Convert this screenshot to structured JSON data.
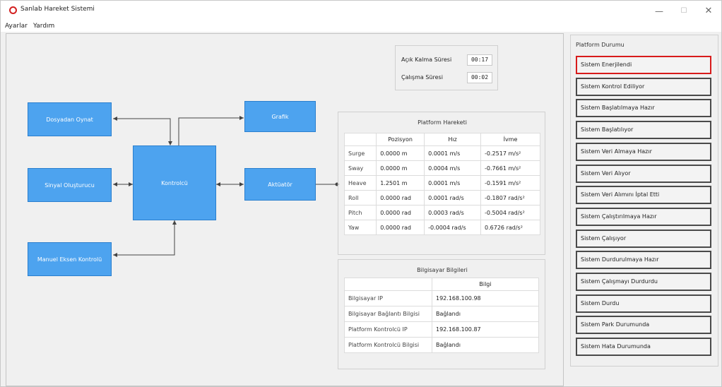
{
  "window": {
    "title": "Sanlab Hareket Sistemi",
    "minimize": "—",
    "maximize": "☐",
    "close": "✕"
  },
  "menu": {
    "items": [
      "Ayarlar",
      "Yardım"
    ]
  },
  "blocks": {
    "file_play": "Dosyadan Oynat",
    "signal_gen": "Sinyal Oluşturucu",
    "manual_axis": "Manuel Eksen Kontrolü",
    "controller": "Kontrolcü",
    "graph": "Grafik",
    "actuator": "Aktüatör"
  },
  "times": {
    "uptime_label": "Açık Kalma Süresi",
    "uptime_value": "00:17",
    "runtime_label": "Çalışma Süresi",
    "runtime_value": "00:02"
  },
  "motion": {
    "title": "Platform Hareketi",
    "headers": [
      "Pozisyon",
      "Hız",
      "İvme"
    ],
    "rows": [
      {
        "name": "Surge",
        "pos": "0.0000 m",
        "vel": "0.0001 m/s",
        "acc": "-0.2517 m/s²"
      },
      {
        "name": "Sway",
        "pos": "0.0000 m",
        "vel": "0.0004 m/s",
        "acc": "-0.7661 m/s²"
      },
      {
        "name": "Heave",
        "pos": "1.2501 m",
        "vel": "0.0001 m/s",
        "acc": "-0.1591 m/s²"
      },
      {
        "name": "Roll",
        "pos": "0.0000 rad",
        "vel": "0.0001 rad/s",
        "acc": "-0.1807 rad/s²"
      },
      {
        "name": "Pitch",
        "pos": "0.0000 rad",
        "vel": "0.0003 rad/s",
        "acc": "-0.5004 rad/s²"
      },
      {
        "name": "Yaw",
        "pos": "0.0000 rad",
        "vel": "-0.0004 rad/s",
        "acc": "0.6726 rad/s²"
      }
    ]
  },
  "computer": {
    "title": "Bilgisayar Bilgileri",
    "header": "Bilgi",
    "rows": [
      {
        "label": "Bilgisayar IP",
        "value": "192.168.100.98"
      },
      {
        "label": "Bilgisayar Bağlantı Bilgisi",
        "value": "Bağlandı"
      },
      {
        "label": "Platform Kontrolcü IP",
        "value": "192.168.100.87"
      },
      {
        "label": "Platform Kontrolcü Bilgisi",
        "value": "Bağlandı"
      }
    ]
  },
  "platform_status": {
    "title": "Platform Durumu",
    "active_index": 0,
    "active_color": "#d81b1b",
    "items": [
      "Sistem Enerjilendi",
      "Sistem Kontrol Ediliyor",
      "Sistem Başlatılmaya Hazır",
      "Sistem Başlatılıyor",
      "Sistem Veri Almaya Hazır",
      "Sistem Veri Alıyor",
      "Sistem Veri Alımını İptal Etti",
      "Sistem Çalıştırılmaya Hazır",
      "Sistem Çalışıyor",
      "Sistem Durdurulmaya Hazır",
      "Sistem Çalışmayı Durdurdu",
      "Sistem Durdu",
      "Sistem Park Durumunda",
      "Sistem Hata Durumunda"
    ]
  }
}
